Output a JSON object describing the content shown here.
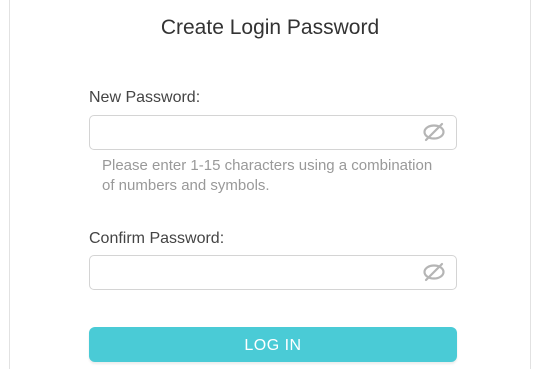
{
  "form": {
    "title": "Create Login Password",
    "new_password": {
      "label": "New Password:",
      "value": "",
      "icon": "eye-slash-icon"
    },
    "hint": "Please enter 1-15 characters using a combination of numbers and symbols.",
    "confirm_password": {
      "label": "Confirm Password:",
      "value": "",
      "icon": "eye-slash-icon"
    },
    "submit_label": "LOG IN"
  },
  "colors": {
    "accent": "#4acbd6",
    "hint_text": "#999999",
    "icon": "#b5b5b5"
  }
}
